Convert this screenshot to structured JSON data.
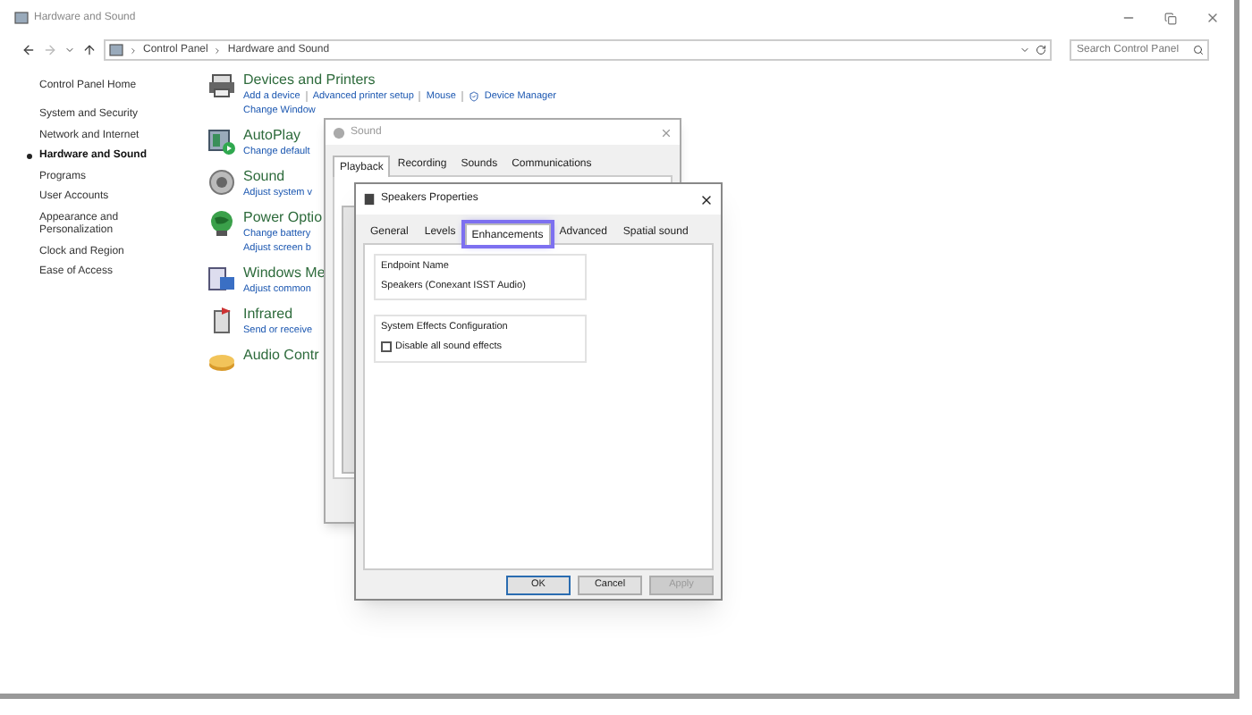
{
  "window": {
    "title": "Hardware and Sound"
  },
  "address": {
    "crumbs": [
      "Control Panel",
      "Hardware and Sound"
    ]
  },
  "search": {
    "placeholder": "Search Control Panel"
  },
  "sidebar": {
    "home": "Control Panel Home",
    "items": [
      {
        "label": "System and Security",
        "selected": false
      },
      {
        "label": "Network and Internet",
        "selected": false
      },
      {
        "label": "Hardware and Sound",
        "selected": true
      },
      {
        "label": "Programs",
        "selected": false
      },
      {
        "label": "User Accounts",
        "selected": false
      },
      {
        "label": "Appearance and Personalization",
        "selected": false
      },
      {
        "label": "Clock and Region",
        "selected": false
      },
      {
        "label": "Ease of Access",
        "selected": false
      }
    ]
  },
  "categories": [
    {
      "title": "Devices and Printers",
      "links": [
        [
          "Add a device",
          "Advanced printer setup",
          "Mouse",
          "Device Manager"
        ],
        [
          "Change Window"
        ]
      ]
    },
    {
      "title": "AutoPlay",
      "links": [
        [
          "Change default"
        ]
      ]
    },
    {
      "title": "Sound",
      "links": [
        [
          "Adjust system v"
        ]
      ]
    },
    {
      "title": "Power Optio",
      "links": [
        [
          "Change battery"
        ],
        [
          "Adjust screen b"
        ]
      ]
    },
    {
      "title": "Windows Me",
      "links": [
        [
          "Adjust common"
        ]
      ]
    },
    {
      "title": "Infrared",
      "links": [
        [
          "Send or receive"
        ]
      ]
    },
    {
      "title": "Audio Contr"
    }
  ],
  "sound_dialog": {
    "title": "Sound",
    "tabs": [
      {
        "label": "Playback",
        "selected": true
      },
      {
        "label": "Recording",
        "selected": false
      },
      {
        "label": "Sounds",
        "selected": false
      },
      {
        "label": "Communications",
        "selected": false
      }
    ]
  },
  "speakers_dialog": {
    "title": "Speakers Properties",
    "tabs": [
      {
        "label": "General",
        "selected": false
      },
      {
        "label": "Levels",
        "selected": false
      },
      {
        "label": "Enhancements",
        "selected": true
      },
      {
        "label": "Advanced",
        "selected": false
      },
      {
        "label": "Spatial sound",
        "selected": false
      }
    ],
    "endpoint": {
      "label": "Endpoint Name",
      "value": "Speakers (Conexant ISST Audio)"
    },
    "effects": {
      "label": "System Effects Configuration",
      "checkbox": {
        "label": "Disable all sound effects",
        "checked": false
      }
    },
    "buttons": [
      {
        "label": "OK",
        "kind": "default",
        "disabled": false
      },
      {
        "label": "Cancel",
        "kind": "normal",
        "disabled": false
      },
      {
        "label": "Apply",
        "kind": "normal",
        "disabled": true
      }
    ]
  }
}
